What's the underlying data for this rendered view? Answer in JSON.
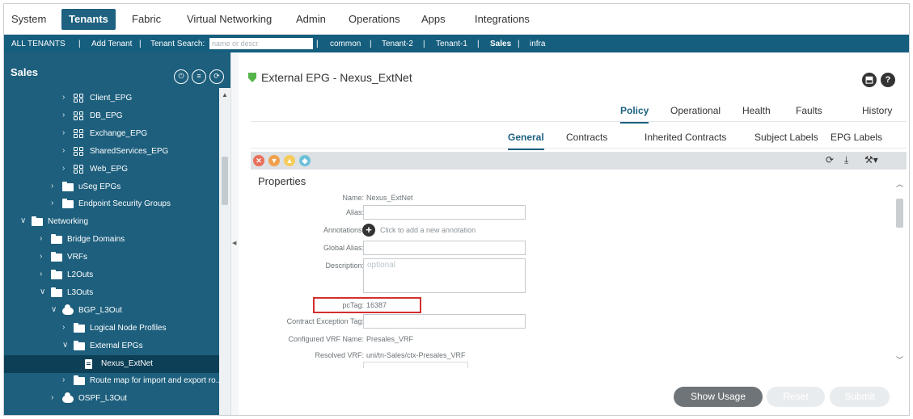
{
  "topnav": {
    "items": [
      "System",
      "Tenants",
      "Fabric",
      "Virtual Networking",
      "Admin",
      "Operations",
      "Apps",
      "Integrations"
    ],
    "active": "Tenants"
  },
  "tenantbar": {
    "all_tenants": "ALL TENANTS",
    "sep": "|",
    "add_tenant": "Add Tenant",
    "search_label": "Tenant Search:",
    "search_placeholder": "name or descr",
    "tenants": [
      "common",
      "Tenant-2",
      "Tenant-1",
      "Sales",
      "infra"
    ],
    "active_tenant": "Sales"
  },
  "left": {
    "title": "Sales",
    "tree": [
      {
        "label": "Client_EPG",
        "icon": "epg-icon",
        "chev": ">"
      },
      {
        "label": "DB_EPG",
        "icon": "epg-icon",
        "chev": ">"
      },
      {
        "label": "Exchange_EPG",
        "icon": "epg-icon",
        "chev": ">"
      },
      {
        "label": "SharedServices_EPG",
        "icon": "epg-icon",
        "chev": ">"
      },
      {
        "label": "Web_EPG",
        "icon": "epg-icon",
        "chev": ">"
      },
      {
        "label": "uSeg EPGs",
        "icon": "folder-icon",
        "chev": ">"
      },
      {
        "label": "Endpoint Security Groups",
        "icon": "folder-icon",
        "chev": ">"
      },
      {
        "label": "Networking",
        "icon": "folder-icon",
        "chev": "v"
      },
      {
        "label": "Bridge Domains",
        "icon": "folder-icon",
        "chev": ">"
      },
      {
        "label": "VRFs",
        "icon": "folder-icon",
        "chev": ">"
      },
      {
        "label": "L2Outs",
        "icon": "folder-icon",
        "chev": ">"
      },
      {
        "label": "L3Outs",
        "icon": "folder-icon",
        "chev": "v"
      },
      {
        "label": "BGP_L3Out",
        "icon": "cloud-icon",
        "chev": "v"
      },
      {
        "label": "Logical Node Profiles",
        "icon": "folder-icon",
        "chev": ">"
      },
      {
        "label": "External EPGs",
        "icon": "folder-icon",
        "chev": "v"
      },
      {
        "label": "Nexus_ExtNet",
        "icon": "document-icon",
        "chev": ""
      },
      {
        "label": "Route map for import and export ro...",
        "icon": "folder-icon",
        "chev": ">"
      },
      {
        "label": "OSPF_L3Out",
        "icon": "cloud-icon",
        "chev": ">"
      }
    ]
  },
  "panel": {
    "title": "External EPG - Nexus_ExtNet",
    "tabs_top": [
      "Policy",
      "Operational",
      "Health",
      "Faults",
      "History"
    ],
    "tabs_sub": [
      "General",
      "Contracts",
      "Inherited Contracts",
      "Subject Labels",
      "EPG Labels"
    ],
    "fault_colors": [
      "#e8705a",
      "#f0a04b",
      "#f5cb5c",
      "#6cc0d8"
    ],
    "properties_title": "Properties",
    "fields": {
      "name_label": "Name:",
      "name_value": "Nexus_ExtNet",
      "alias_label": "Alias:",
      "annotations_label": "Annotations:",
      "annotations_add": "Click to add a new annotation",
      "global_alias_label": "Global Alias:",
      "description_label": "Description:",
      "description_placeholder": "optional",
      "pctag_label": "pcTag:",
      "pctag_value": "16387",
      "contract_exception_label": "Contract Exception Tag:",
      "configured_vrf_label": "Configured VRF Name:",
      "configured_vrf_value": "Presales_VRF",
      "resolved_vrf_label": "Resolved VRF:",
      "resolved_vrf_value": "uni/tn-Sales/ctx-Presales_VRF"
    },
    "buttons": {
      "show_usage": "Show Usage",
      "reset": "Reset",
      "submit": "Submit"
    }
  },
  "colors": {
    "brand": "#155e7e",
    "tree_bg": "#1d5f7d",
    "selected": "#0d3f57",
    "highlight": "#d32f2f"
  }
}
